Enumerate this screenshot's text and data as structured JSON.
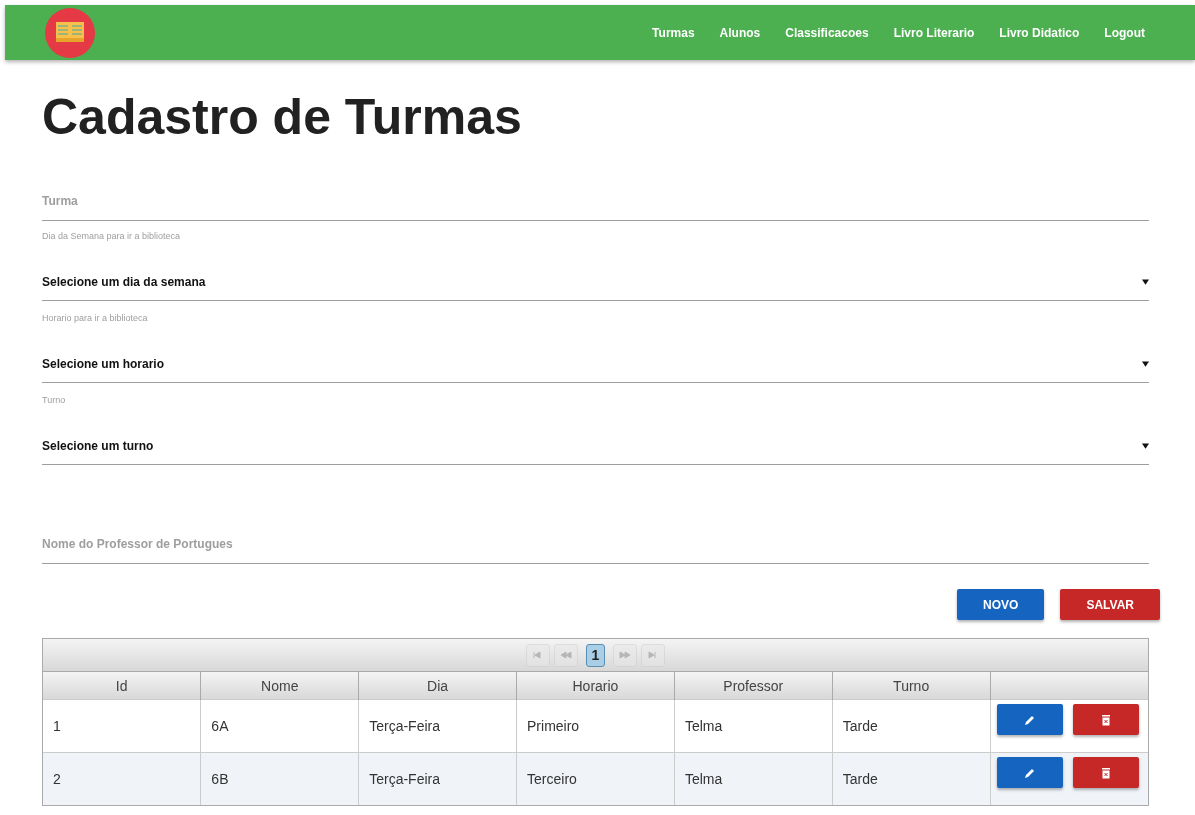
{
  "navbar": {
    "links": [
      "Turmas",
      "Alunos",
      "Classificacoes",
      "Livro Literario",
      "Livro Didatico",
      "Logout"
    ]
  },
  "title": "Cadastro de Turmas",
  "form": {
    "fields": [
      {
        "kind": "text",
        "placeholder": "Turma"
      },
      {
        "kind": "select",
        "label": "Dia da Semana para ir a biblioteca",
        "value": "Selecione um dia da semana"
      },
      {
        "kind": "select",
        "label": "Horario para ir a biblioteca",
        "value": "Selecione um horario"
      },
      {
        "kind": "select",
        "label": "Turno",
        "value": "Selecione um turno"
      },
      {
        "kind": "text",
        "placeholder": "Nome do Professor de Portugues"
      }
    ],
    "buttons": [
      {
        "kind": "primary",
        "label": "NOVO"
      },
      {
        "kind": "danger",
        "label": "SALVAR"
      }
    ]
  },
  "table": {
    "pager": {
      "buttons": [
        {
          "kind": "first",
          "disabled": true
        },
        {
          "kind": "prev",
          "disabled": true
        },
        {
          "kind": "page",
          "label": "1",
          "selected": true
        },
        {
          "kind": "next",
          "disabled": true
        },
        {
          "kind": "last",
          "disabled": true
        }
      ]
    },
    "columns": [
      "Id",
      "Nome",
      "Dia",
      "Horario",
      "Professor",
      "Turno"
    ],
    "rows": [
      {
        "cells": [
          "1",
          "6A",
          "Terça-Feira",
          "Primeiro",
          "Telma",
          "Tarde"
        ]
      },
      {
        "cells": [
          "2",
          "6B",
          "Terça-Feira",
          "Terceiro",
          "Telma",
          "Tarde"
        ]
      }
    ]
  }
}
